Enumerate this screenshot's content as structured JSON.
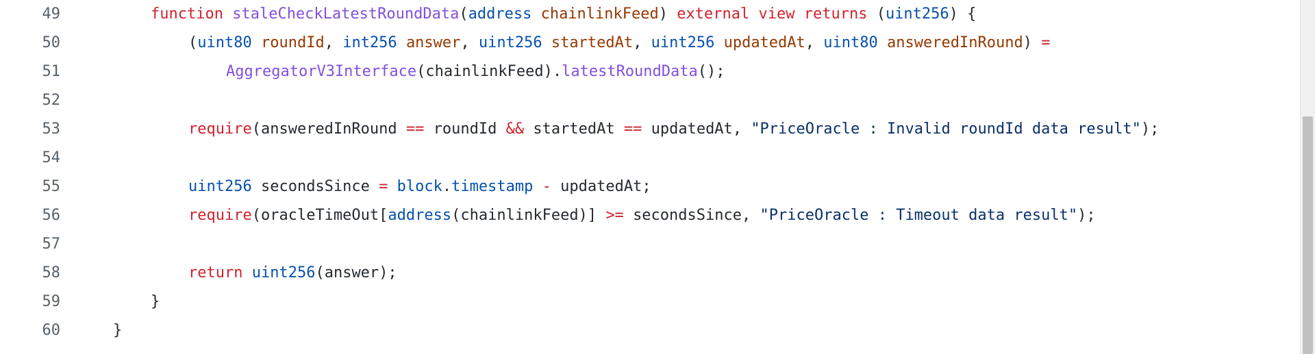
{
  "editor": {
    "lines": [
      {
        "number": "49",
        "indent": 2,
        "tokens": [
          {
            "text": "function",
            "kind": "keyword"
          },
          {
            "text": " ",
            "kind": "plain"
          },
          {
            "text": "staleCheckLatestRoundData",
            "kind": "fn"
          },
          {
            "text": "(",
            "kind": "punc"
          },
          {
            "text": "address",
            "kind": "type"
          },
          {
            "text": " ",
            "kind": "plain"
          },
          {
            "text": "chainlinkFeed",
            "kind": "var"
          },
          {
            "text": ")",
            "kind": "punc"
          },
          {
            "text": " ",
            "kind": "plain"
          },
          {
            "text": "external",
            "kind": "keyword"
          },
          {
            "text": " ",
            "kind": "plain"
          },
          {
            "text": "view",
            "kind": "keyword"
          },
          {
            "text": " ",
            "kind": "plain"
          },
          {
            "text": "returns",
            "kind": "keyword"
          },
          {
            "text": " ",
            "kind": "plain"
          },
          {
            "text": "(",
            "kind": "punc"
          },
          {
            "text": "uint256",
            "kind": "type"
          },
          {
            "text": ")",
            "kind": "punc"
          },
          {
            "text": " {",
            "kind": "punc"
          }
        ]
      },
      {
        "number": "50",
        "indent": 3,
        "tokens": [
          {
            "text": "(",
            "kind": "punc"
          },
          {
            "text": "uint80",
            "kind": "type"
          },
          {
            "text": " ",
            "kind": "plain"
          },
          {
            "text": "roundId",
            "kind": "var"
          },
          {
            "text": ", ",
            "kind": "punc"
          },
          {
            "text": "int256",
            "kind": "type"
          },
          {
            "text": " ",
            "kind": "plain"
          },
          {
            "text": "answer",
            "kind": "var"
          },
          {
            "text": ", ",
            "kind": "punc"
          },
          {
            "text": "uint256",
            "kind": "type"
          },
          {
            "text": " ",
            "kind": "plain"
          },
          {
            "text": "startedAt",
            "kind": "var"
          },
          {
            "text": ", ",
            "kind": "punc"
          },
          {
            "text": "uint256",
            "kind": "type"
          },
          {
            "text": " ",
            "kind": "plain"
          },
          {
            "text": "updatedAt",
            "kind": "var"
          },
          {
            "text": ", ",
            "kind": "punc"
          },
          {
            "text": "uint80",
            "kind": "type"
          },
          {
            "text": " ",
            "kind": "plain"
          },
          {
            "text": "answeredInRound",
            "kind": "var"
          },
          {
            "text": ")",
            "kind": "punc"
          },
          {
            "text": " ",
            "kind": "plain"
          },
          {
            "text": "=",
            "kind": "op"
          }
        ]
      },
      {
        "number": "51",
        "indent": 4,
        "tokens": [
          {
            "text": "AggregatorV3Interface",
            "kind": "fn"
          },
          {
            "text": "(",
            "kind": "punc"
          },
          {
            "text": "chainlinkFeed",
            "kind": "plain"
          },
          {
            "text": ").",
            "kind": "punc"
          },
          {
            "text": "latestRoundData",
            "kind": "fn"
          },
          {
            "text": "();",
            "kind": "punc"
          }
        ]
      },
      {
        "number": "52",
        "indent": 0,
        "tokens": []
      },
      {
        "number": "53",
        "indent": 3,
        "tokens": [
          {
            "text": "require",
            "kind": "keyword"
          },
          {
            "text": "(",
            "kind": "punc"
          },
          {
            "text": "answeredInRound",
            "kind": "plain"
          },
          {
            "text": " ",
            "kind": "plain"
          },
          {
            "text": "==",
            "kind": "op"
          },
          {
            "text": " ",
            "kind": "plain"
          },
          {
            "text": "roundId",
            "kind": "plain"
          },
          {
            "text": " ",
            "kind": "plain"
          },
          {
            "text": "&&",
            "kind": "op"
          },
          {
            "text": " ",
            "kind": "plain"
          },
          {
            "text": "startedAt",
            "kind": "plain"
          },
          {
            "text": " ",
            "kind": "plain"
          },
          {
            "text": "==",
            "kind": "op"
          },
          {
            "text": " ",
            "kind": "plain"
          },
          {
            "text": "updatedAt",
            "kind": "plain"
          },
          {
            "text": ", ",
            "kind": "punc"
          },
          {
            "text": "\"PriceOracle : Invalid roundId data result\"",
            "kind": "str"
          },
          {
            "text": ");",
            "kind": "punc"
          }
        ]
      },
      {
        "number": "54",
        "indent": 0,
        "tokens": []
      },
      {
        "number": "55",
        "indent": 3,
        "tokens": [
          {
            "text": "uint256",
            "kind": "type"
          },
          {
            "text": " ",
            "kind": "plain"
          },
          {
            "text": "secondsSince",
            "kind": "plain"
          },
          {
            "text": " ",
            "kind": "plain"
          },
          {
            "text": "=",
            "kind": "op"
          },
          {
            "text": " ",
            "kind": "plain"
          },
          {
            "text": "block",
            "kind": "prop"
          },
          {
            "text": ".",
            "kind": "punc"
          },
          {
            "text": "timestamp",
            "kind": "prop"
          },
          {
            "text": " ",
            "kind": "plain"
          },
          {
            "text": "-",
            "kind": "op"
          },
          {
            "text": " ",
            "kind": "plain"
          },
          {
            "text": "updatedAt",
            "kind": "plain"
          },
          {
            "text": ";",
            "kind": "punc"
          }
        ]
      },
      {
        "number": "56",
        "indent": 3,
        "tokens": [
          {
            "text": "require",
            "kind": "keyword"
          },
          {
            "text": "(",
            "kind": "punc"
          },
          {
            "text": "oracleTimeOut",
            "kind": "plain"
          },
          {
            "text": "[",
            "kind": "punc"
          },
          {
            "text": "address",
            "kind": "type"
          },
          {
            "text": "(",
            "kind": "punc"
          },
          {
            "text": "chainlinkFeed",
            "kind": "plain"
          },
          {
            "text": ")]",
            "kind": "punc"
          },
          {
            "text": " ",
            "kind": "plain"
          },
          {
            "text": ">=",
            "kind": "op"
          },
          {
            "text": " ",
            "kind": "plain"
          },
          {
            "text": "secondsSince",
            "kind": "plain"
          },
          {
            "text": ", ",
            "kind": "punc"
          },
          {
            "text": "\"PriceOracle : Timeout data result\"",
            "kind": "str"
          },
          {
            "text": ");",
            "kind": "punc"
          }
        ]
      },
      {
        "number": "57",
        "indent": 0,
        "tokens": []
      },
      {
        "number": "58",
        "indent": 3,
        "tokens": [
          {
            "text": "return",
            "kind": "keyword"
          },
          {
            "text": " ",
            "kind": "plain"
          },
          {
            "text": "uint256",
            "kind": "type"
          },
          {
            "text": "(",
            "kind": "punc"
          },
          {
            "text": "answer",
            "kind": "plain"
          },
          {
            "text": ");",
            "kind": "punc"
          }
        ]
      },
      {
        "number": "59",
        "indent": 2,
        "tokens": [
          {
            "text": "}",
            "kind": "punc"
          }
        ]
      },
      {
        "number": "60",
        "indent": 1,
        "tokens": [
          {
            "text": "}",
            "kind": "punc"
          }
        ]
      }
    ]
  },
  "colors": {
    "background": "#ffffff",
    "line_number": "#57606a",
    "keyword": "#cf222e",
    "type": "#0550ae",
    "function": "#8250df",
    "variable": "#953800",
    "string": "#0a3069",
    "text": "#24292f",
    "scrollbar_track": "#f1f1f1",
    "scrollbar_thumb": "#c1c1c1"
  }
}
